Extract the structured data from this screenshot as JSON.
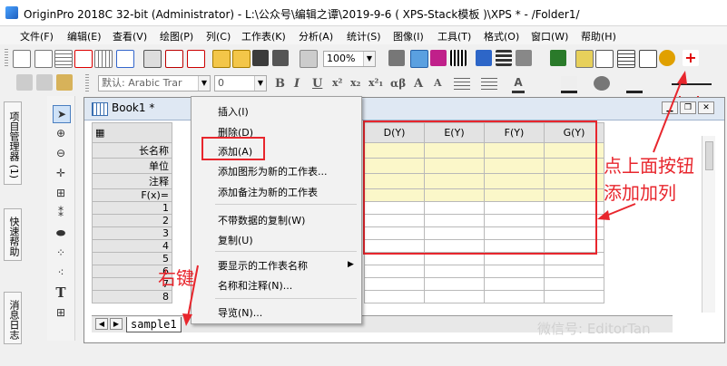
{
  "window": {
    "title": "OriginPro 2018C 32-bit (Administrator) - L:\\公众号\\编辑之谭\\2019-9-6 ( XPS-Stack模板 )\\XPS * - /Folder1/"
  },
  "menu": [
    "文件(F)",
    "编辑(E)",
    "查看(V)",
    "绘图(P)",
    "列(C)",
    "工作表(K)",
    "分析(A)",
    "统计(S)",
    "图像(I)",
    "工具(T)",
    "格式(O)",
    "窗口(W)",
    "帮助(H)"
  ],
  "toolbar": {
    "zoom_value": "100%",
    "font_placeholder": "默认: Arabic Trar",
    "font_size": "0",
    "format_buttons": [
      "B",
      "I",
      "U",
      "x²",
      "x₂",
      "x²₁",
      "αβ",
      "A",
      "A"
    ]
  },
  "side_tabs": [
    "项目管理器 (1)",
    "快速帮助",
    "消息日志"
  ],
  "tools": [
    "pointer-tool",
    "zoom-in-tool",
    "zoom-out-tool",
    "data-reader-tool",
    "region-tool",
    "mask-tool",
    "draw-data-tool",
    "screen-reader-tool",
    "text-tool",
    "add-table-tool"
  ],
  "text_tool_label": "T",
  "book": {
    "title": "Book1 *",
    "row_labels": [
      "长名称",
      "单位",
      "注释",
      "F(x)="
    ],
    "row_numbers": [
      "1",
      "2",
      "3",
      "4",
      "5",
      "6",
      "7",
      "8"
    ],
    "visible_columns": [
      "D(Y)",
      "E(Y)",
      "F(Y)",
      "G(Y)"
    ],
    "sheet_name": "sample1"
  },
  "context_menu": {
    "items": [
      "插入(I)",
      "删除(D)",
      "添加(A)",
      "添加图形为新的工作表...",
      "添加备注为新的工作表",
      "不带数据的复制(W)",
      "复制(U)",
      "要显示的工作表名称",
      "名称和注释(N)...",
      "导览(N)..."
    ],
    "highlighted": "添加(A)"
  },
  "annotations": {
    "right_click": "右键",
    "hint_line1": "点上面按钮",
    "hint_line2": "添加加列",
    "color": "#e8262d"
  },
  "watermark": "微信号: EditorTan"
}
